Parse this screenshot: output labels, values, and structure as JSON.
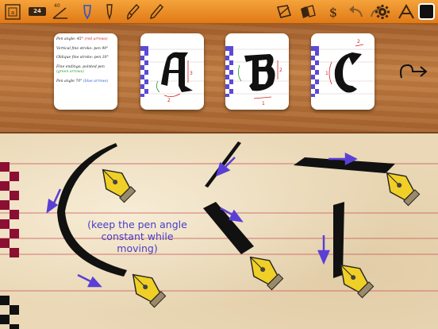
{
  "toolbar": {
    "nib_width": "24",
    "pen_angle": "40",
    "tools_left": [
      "grid-icon",
      "nib-width-icon",
      "pen-angle-icon",
      "pen-icon",
      "nib-pen-icon",
      "brush-icon",
      "pencil-icon"
    ],
    "tools_right": [
      "crop-icon",
      "templates-icon",
      "dollar-icon",
      "undo-icon",
      "redo-icon",
      "gear-icon",
      "fonts-icon",
      "color-swatch"
    ],
    "color": "#111111"
  },
  "info_card": {
    "lines": [
      {
        "text": "Pen angle: 45°",
        "note": "(red arrows)",
        "note_color": "red"
      },
      {
        "text": "Vertical fine stroke: pen 90°",
        "note": "",
        "note_color": ""
      },
      {
        "text": "Oblique fine stroke: pen 30°",
        "note": "",
        "note_color": ""
      },
      {
        "text": "Fine endings: pointed pen",
        "note": "(green arrows)",
        "note_color": "green"
      },
      {
        "text": "Pen angle 70°",
        "note": "(blue arrows)",
        "note_color": "blue"
      }
    ]
  },
  "letter_cards": [
    {
      "letter": "A",
      "selected": false
    },
    {
      "letter": "B",
      "selected": false
    },
    {
      "letter": "C",
      "selected": false
    }
  ],
  "canvas": {
    "hint": "(keep the pen angle constant while moving)",
    "ink_color": "#000000",
    "arrow_color": "#5a3fd6",
    "guide_line_color": "#c9525a",
    "left_checker_color": "#8b0f33"
  }
}
